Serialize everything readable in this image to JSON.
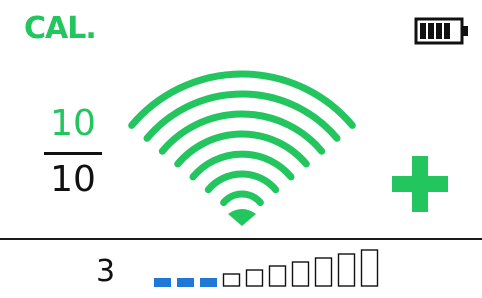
{
  "status": {
    "mode_label": "CAL.",
    "battery_level": 0.8,
    "battery_icon": "battery-icon"
  },
  "fraction": {
    "numerator": "10",
    "denominator": "10"
  },
  "signal": {
    "icon": "wifi-signal-icon",
    "arcs": 7
  },
  "action": {
    "icon": "plus-icon"
  },
  "level": {
    "value": "3",
    "max_segments": 10
  },
  "colors": {
    "green": "#22c55e",
    "blue": "#1e78d7",
    "dark": "#111111"
  }
}
